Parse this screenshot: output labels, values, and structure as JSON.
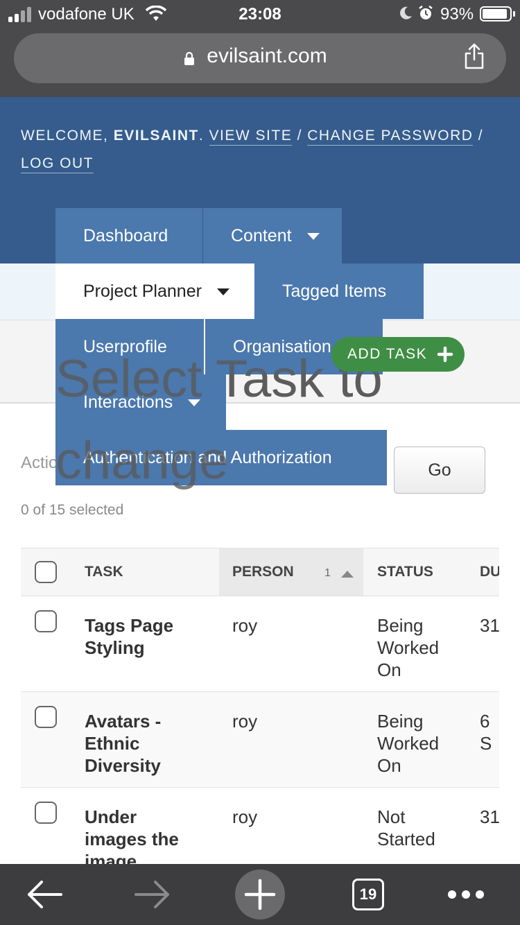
{
  "status_bar": {
    "carrier": "vodafone UK",
    "time": "23:08",
    "battery": "93%",
    "battery_level": 0.93
  },
  "browser": {
    "url": "evilsaint.com",
    "tab_count": "19"
  },
  "user_tools": {
    "welcome": "Welcome,",
    "username": "EVILSAINT",
    "view_site": "View site",
    "change_password": "Change password",
    "log_out": "Log out",
    "separator": "/"
  },
  "nav_menu": {
    "dashboard": "Dashboard",
    "content": "Content",
    "project_planner": "Project Planner",
    "tagged_items": "Tagged Items",
    "userprofile": "Userprofile",
    "organisation": "Organisation",
    "interactions": "Interactions",
    "auth": "Authentication and Authorization"
  },
  "page": {
    "title": "Select Task to change",
    "add_button": "ADD TASK"
  },
  "actions": {
    "label": "Action:",
    "go": "Go",
    "selected": "0 of 15 selected"
  },
  "table": {
    "columns": [
      "TASK",
      "PERSON",
      "STATUS",
      "DUE"
    ],
    "sort_index": "1",
    "rows": [
      {
        "task": "Tags Page Styling",
        "person": "roy",
        "status": "Being Worked On",
        "due": "31"
      },
      {
        "task": "Avatars - Ethnic Diversity",
        "person": "roy",
        "status": "Being Worked On",
        "due": "6 S"
      },
      {
        "task": "Under images the image",
        "person": "roy",
        "status": "Not Started",
        "due": "31"
      }
    ]
  },
  "colors": {
    "header_blue": "#355c8c",
    "menu_blue": "#4b78ad",
    "add_green": "#3f8e45"
  }
}
